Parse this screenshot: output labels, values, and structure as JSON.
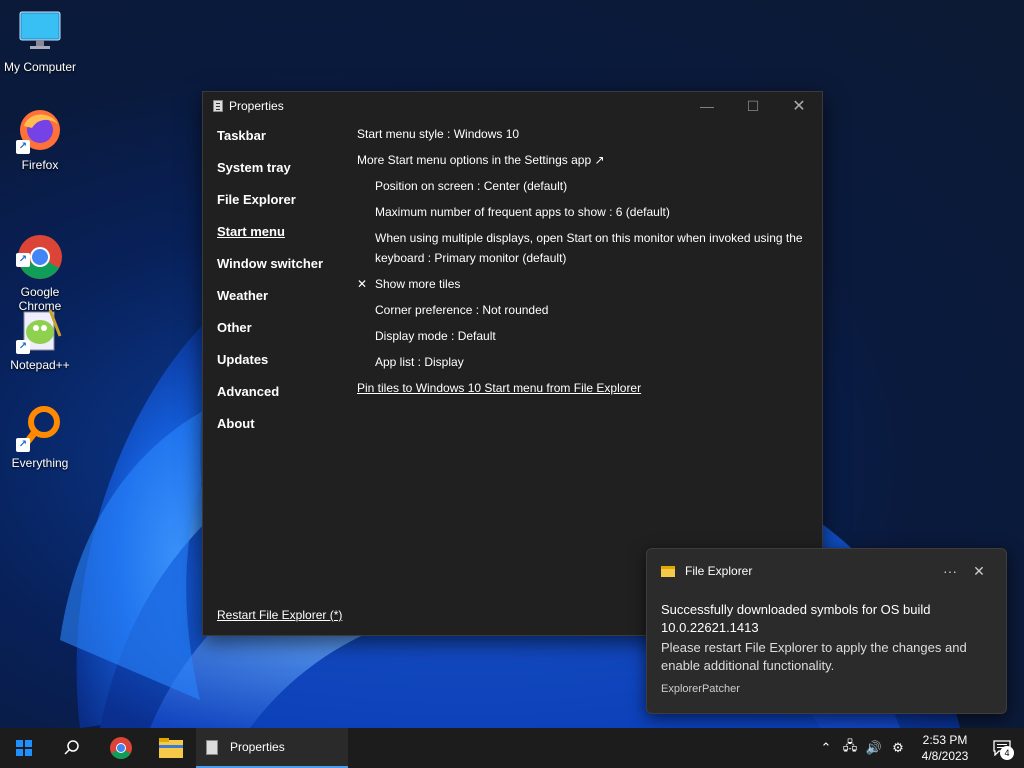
{
  "desktop": {
    "icons": [
      {
        "label": "My Computer"
      },
      {
        "label": "Firefox"
      },
      {
        "label": "Google\nChrome"
      },
      {
        "label": "Notepad++"
      },
      {
        "label": "Everything"
      }
    ]
  },
  "window": {
    "title": "Properties",
    "nav": [
      {
        "label": "Taskbar"
      },
      {
        "label": "System tray"
      },
      {
        "label": "File Explorer"
      },
      {
        "label": "Start menu"
      },
      {
        "label": "Window switcher"
      },
      {
        "label": "Weather"
      },
      {
        "label": "Other"
      },
      {
        "label": "Updates"
      },
      {
        "label": "Advanced"
      },
      {
        "label": "About"
      }
    ],
    "active_nav": "Start menu",
    "content": {
      "start_style": "Start menu style : Windows 10",
      "more_options": "More Start menu options in the Settings app ↗",
      "position": "Position on screen : Center (default)",
      "max_frequent": "Maximum number of frequent apps to show : 6 (default)",
      "multi_display": "When using multiple displays, open Start on this monitor when invoked using the keyboard : Primary monitor (default)",
      "show_more_tiles": "Show more tiles",
      "show_more_tiles_mark": "✕",
      "corner": "Corner preference : Not rounded",
      "display_mode": "Display mode : Default",
      "app_list": "App list : Display",
      "pin_tiles": "Pin tiles to Windows 10 Start menu from File Explorer"
    },
    "restart_link": "Restart File Explorer (*)"
  },
  "toast": {
    "app": "File Explorer",
    "title": "Successfully downloaded symbols for OS build 10.0.22621.1413",
    "text": "Please restart File Explorer to apply the changes and enable additional functionality.",
    "attribution": "ExplorerPatcher",
    "more_glyph": "···",
    "close_glyph": "✕"
  },
  "taskbar": {
    "active_app_label": "Properties",
    "time": "2:53 PM",
    "date": "4/8/2023",
    "notification_count": "4"
  },
  "colors": {
    "accent": "#4c9ded",
    "window_bg": "#202020",
    "taskbar_bg": "#1c1c1c"
  }
}
